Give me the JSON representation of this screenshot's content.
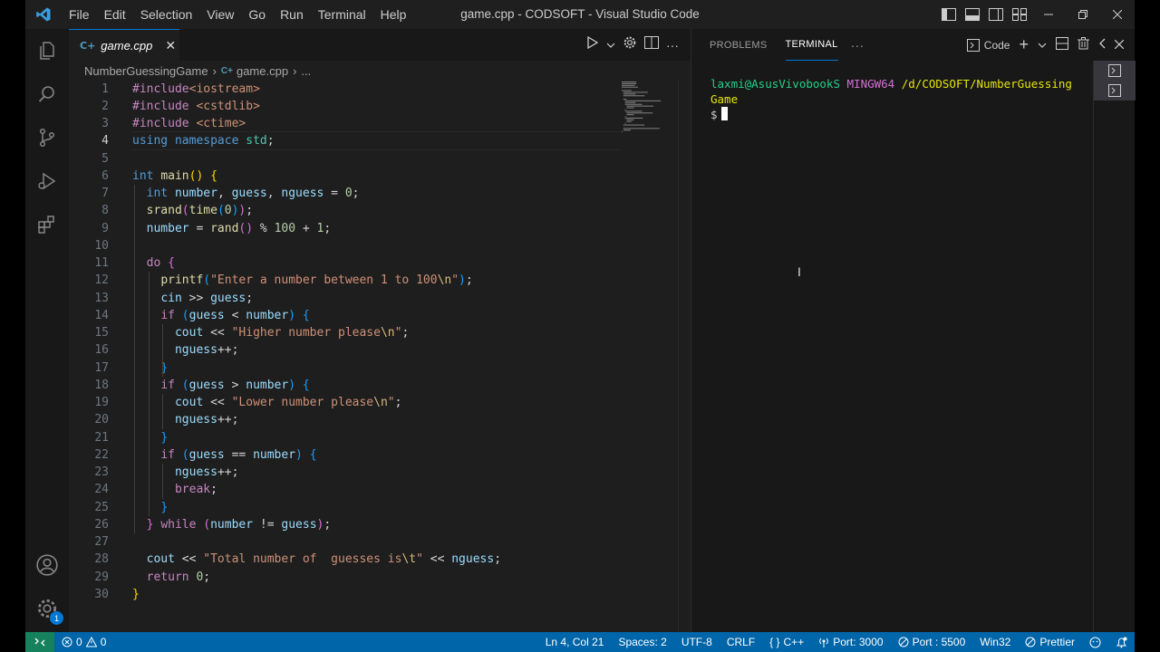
{
  "window": {
    "title": "game.cpp - CODSOFT - Visual Studio Code",
    "menu": [
      "File",
      "Edit",
      "Selection",
      "View",
      "Go",
      "Run",
      "Terminal",
      "Help"
    ]
  },
  "editor": {
    "tab": {
      "icon_text": "C+",
      "filename": "game.cpp"
    },
    "breadcrumb": {
      "folder": "NumberGuessingGame",
      "icon_text": "C+",
      "file": "game.cpp",
      "more": "..."
    },
    "active_line": 4,
    "lines": [
      "#include<iostream>",
      "#include <cstdlib>",
      "#include <ctime>",
      "using namespace std;",
      "",
      "int main() {",
      "  int number, guess, nguess = 0;",
      "  srand(time(0));",
      "  number = rand() % 100 + 1;",
      "",
      "  do {",
      "    printf(\"Enter a number between 1 to 100\\n\");",
      "    cin >> guess;",
      "    if (guess < number) {",
      "      cout << \"Higher number please\\n\";",
      "      nguess++;",
      "    }",
      "    if (guess > number) {",
      "      cout << \"Lower number please\\n\";",
      "      nguess++;",
      "    }",
      "    if (guess == number) {",
      "      nguess++;",
      "      break;",
      "    }",
      "  } while (number != guess);",
      "",
      "  cout << \"Total number of  guesses is\\t\" << nguess;",
      "  return 0;",
      "}"
    ]
  },
  "panel": {
    "tabs": [
      "PROBLEMS",
      "TERMINAL"
    ],
    "active_tab": "TERMINAL",
    "more": "···",
    "terminal_profile": "Code",
    "terminal": {
      "user": "laxmi@AsusVivobookS",
      "system": "MINGW64",
      "path_line1": "/d/CODSOFT/NumberGuessing",
      "path_line2": "Game",
      "prompt": "$"
    }
  },
  "status": {
    "errors": "0",
    "warnings": "0",
    "position": "Ln 4, Col 21",
    "spaces": "Spaces: 2",
    "encoding": "UTF-8",
    "eol": "CRLF",
    "language_icon": "{ }",
    "language": "C++",
    "port1": "Port: 3000",
    "port2": "Port : 5500",
    "platform": "Win32",
    "formatter": "Prettier",
    "accounts_badge": "1"
  },
  "colors": {
    "accent": "#0078d4",
    "statusbar": "#0065a9",
    "remote": "#16825d"
  }
}
